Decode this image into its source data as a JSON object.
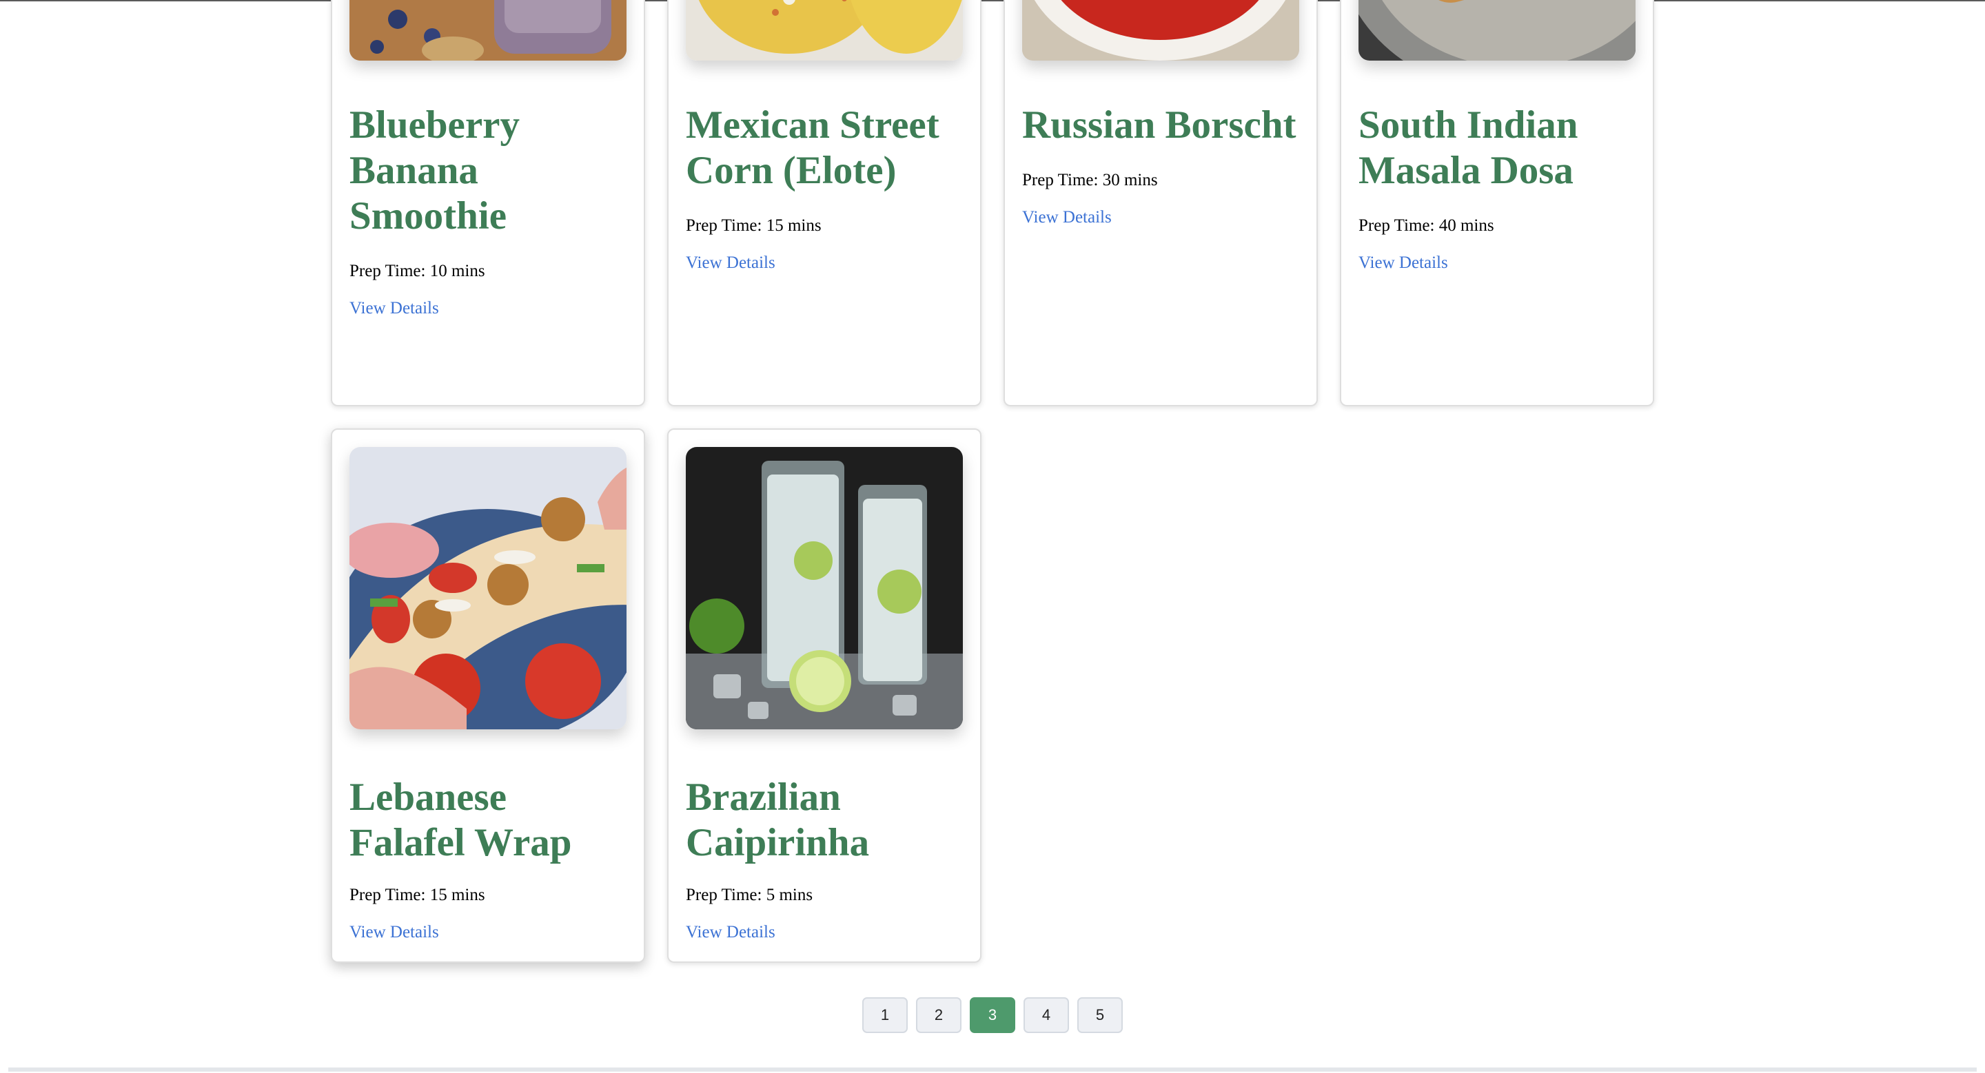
{
  "recipes": [
    {
      "title": "Blueberry Banana Smoothie",
      "prep": "Prep Time: 10 mins",
      "link": "View Details"
    },
    {
      "title": "Mexican Street Corn (Elote)",
      "prep": "Prep Time: 15 mins",
      "link": "View Details"
    },
    {
      "title": "Russian Borscht",
      "prep": "Prep Time: 30 mins",
      "link": "View Details"
    },
    {
      "title": "South Indian Masala Dosa",
      "prep": "Prep Time: 40 mins",
      "link": "View Details"
    },
    {
      "title": "Lebanese Falafel Wrap",
      "prep": "Prep Time: 15 mins",
      "link": "View Details"
    },
    {
      "title": "Brazilian Caipirinha",
      "prep": "Prep Time: 5 mins",
      "link": "View Details"
    }
  ],
  "pagination": {
    "pages": [
      "1",
      "2",
      "3",
      "4",
      "5"
    ],
    "current": "3"
  },
  "colors": {
    "title": "#3e7d56",
    "link": "#3c72d4",
    "active_page": "#4e9a6c"
  }
}
